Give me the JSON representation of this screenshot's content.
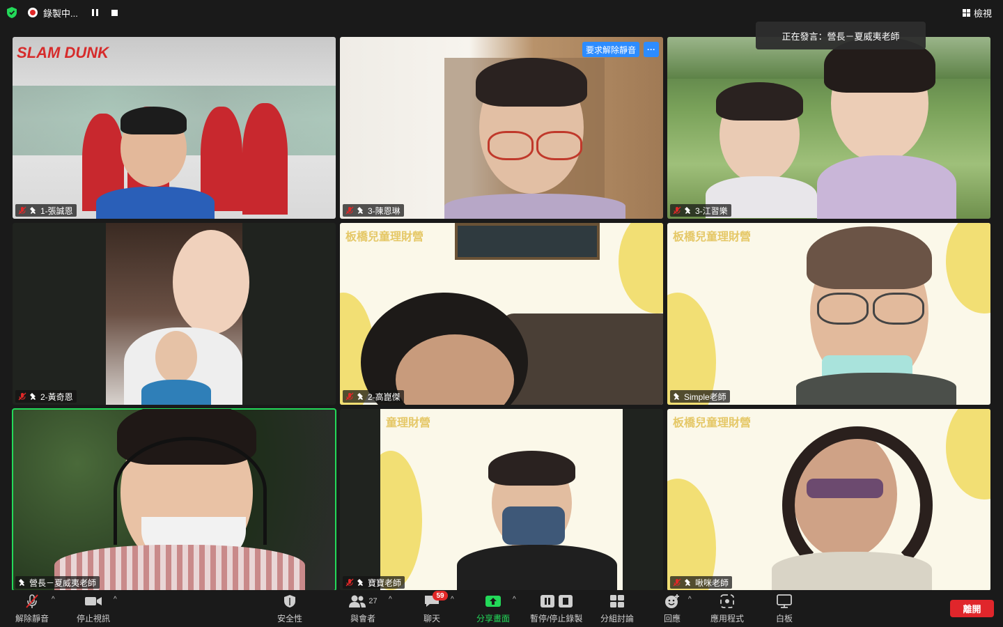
{
  "topbar": {
    "recording_label": "錄製中...",
    "view_label": "檢視"
  },
  "speaker_toast": "正在發言：營長－夏威夷老師",
  "tiles": [
    {
      "name": "1-張誠恩",
      "muted": true,
      "background": "slamdunk",
      "logo_text": "SLAM DUNK"
    },
    {
      "name": "3-陳恩琳",
      "muted": true,
      "background": "room",
      "unmute_request": "要求解除靜音",
      "more": "···"
    },
    {
      "name": "3-江習樂",
      "muted": true,
      "background": "grass"
    },
    {
      "name": "2-黃奇恩",
      "muted": true,
      "background": "dark"
    },
    {
      "name": "2-高崑傑",
      "muted": true,
      "background": "yellow",
      "watermark": "板橋兒童理財營"
    },
    {
      "name": "Simple老師",
      "muted": false,
      "background": "yellow",
      "watermark": "板橋兒童理財營"
    },
    {
      "name": "營長－夏威夷老師",
      "muted": false,
      "background": "leaves",
      "active_speaker": true
    },
    {
      "name": "寶寶老師",
      "muted": true,
      "background": "yellow",
      "watermark": "童理財營"
    },
    {
      "name": "啾咪老師",
      "muted": true,
      "background": "yellow",
      "watermark": "板橋兒童理財營"
    }
  ],
  "toolbar": {
    "unmute": "解除靜音",
    "stop_video": "停止視訊",
    "security": "安全性",
    "participants": "與會者",
    "participants_count": "27",
    "chat": "聊天",
    "chat_badge": "59",
    "share": "分享畫面",
    "pause_record": "暫停/停止錄製",
    "breakout": "分組討論",
    "reactions": "回應",
    "apps": "應用程式",
    "whiteboard": "白板",
    "leave": "離開"
  },
  "colors": {
    "accent_green": "#23d959",
    "accent_blue": "#2d8cff",
    "leave_red": "#e0262b",
    "badge_red": "#e02828"
  }
}
